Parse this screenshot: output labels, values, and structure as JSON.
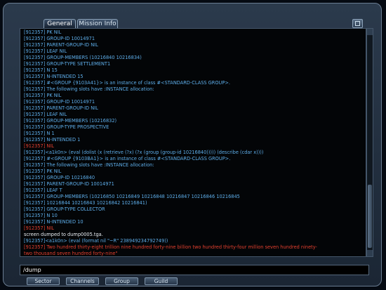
{
  "tabs": [
    {
      "label": "General",
      "active": true
    },
    {
      "label": "Mission Info",
      "active": false
    }
  ],
  "chat_lines": [
    {
      "text": "[912357] PK                NIL",
      "color": "blue"
    },
    {
      "text": "[912357] GROUP-ID          10014971",
      "color": "blue"
    },
    {
      "text": "[912357] PARENT-GROUP-ID   NIL",
      "color": "blue"
    },
    {
      "text": "[912357] LEAF              NIL",
      "color": "blue"
    },
    {
      "text": "[912357] GROUP-MEMBERS     (10216840 10216834)",
      "color": "blue"
    },
    {
      "text": "[912357] GROUP-TYPE        SETTLEMENT1",
      "color": "blue"
    },
    {
      "text": "[912357] N                 15",
      "color": "blue"
    },
    {
      "text": "[912357] N-INTENDED        15",
      "color": "blue"
    },
    {
      "text": "[912357] #<GROUP {9103A41}> is an instance of class #<STANDARD-CLASS GROUP>.",
      "color": "blue"
    },
    {
      "text": "[912357] The following slots have :INSTANCE allocation:",
      "color": "blue"
    },
    {
      "text": "[912357] PK                NIL",
      "color": "blue"
    },
    {
      "text": "[912357] GROUP-ID          10014971",
      "color": "blue"
    },
    {
      "text": "[912357] PARENT-GROUP-ID   NIL",
      "color": "blue"
    },
    {
      "text": "[912357] LEAF              NIL",
      "color": "blue"
    },
    {
      "text": "[912357] GROUP-MEMBERS     (10216832)",
      "color": "blue"
    },
    {
      "text": "[912357] GROUP-TYPE        PROSPECTIVE",
      "color": "blue"
    },
    {
      "text": "[912357] N                 1",
      "color": "blue"
    },
    {
      "text": "[912357] N-INTENDED        1",
      "color": "blue"
    },
    {
      "text": "[912357] NIL",
      "color": "red"
    },
    {
      "text": "[912357]<a1k0n> (eval (dolist (x (retrieve (?x) (?x (group (group-id 10216840))))) (describe (cdar x))))",
      "color": "blue"
    },
    {
      "text": "[912357] #<GROUP {9103BA1}> is an instance of class #<STANDARD-CLASS GROUP>.",
      "color": "blue"
    },
    {
      "text": "[912357] The following slots have :INSTANCE allocation:",
      "color": "blue"
    },
    {
      "text": "[912357] PK                NIL",
      "color": "blue"
    },
    {
      "text": "[912357] GROUP-ID          10216840",
      "color": "blue"
    },
    {
      "text": "[912357] PARENT-GROUP-ID   10014971",
      "color": "blue"
    },
    {
      "text": "[912357] LEAF              T",
      "color": "blue"
    },
    {
      "text": "[912357] GROUP-MEMBERS     (10216850 10216849 10216848 10216847 10216846 10216845",
      "color": "blue"
    },
    {
      "text": "[912357]                   10216844 10216843 10216842 10216841)",
      "color": "blue"
    },
    {
      "text": "[912357] GROUP-TYPE        COLLECTOR",
      "color": "blue"
    },
    {
      "text": "[912357] N                 10",
      "color": "blue"
    },
    {
      "text": "[912357] N-INTENDED        10",
      "color": "blue"
    },
    {
      "text": "[912357] NIL",
      "color": "red"
    },
    {
      "text": "screen dumped to dump0005.tga.",
      "color": "blue"
    },
    {
      "text": "[912357]<a1k0n> (eval (format nil \"~R\" 238949234792749))",
      "color": "blue"
    },
    {
      "text": "[912357] Two hundred thirty-eight trillion nine hundred forty-nine billion two hundred thirty-four million seven hundred ninety-",
      "color": "red"
    },
    {
      "text": "           two thousand seven hundred forty-nine\"",
      "color": "red"
    }
  ],
  "input": {
    "value": "/dump"
  },
  "bottom_tabs": [
    "Sector",
    "Channels",
    "Group",
    "Guild"
  ],
  "colors": {
    "blue": "#5eaeea",
    "red": "#e4402f",
    "background": "#030507"
  }
}
